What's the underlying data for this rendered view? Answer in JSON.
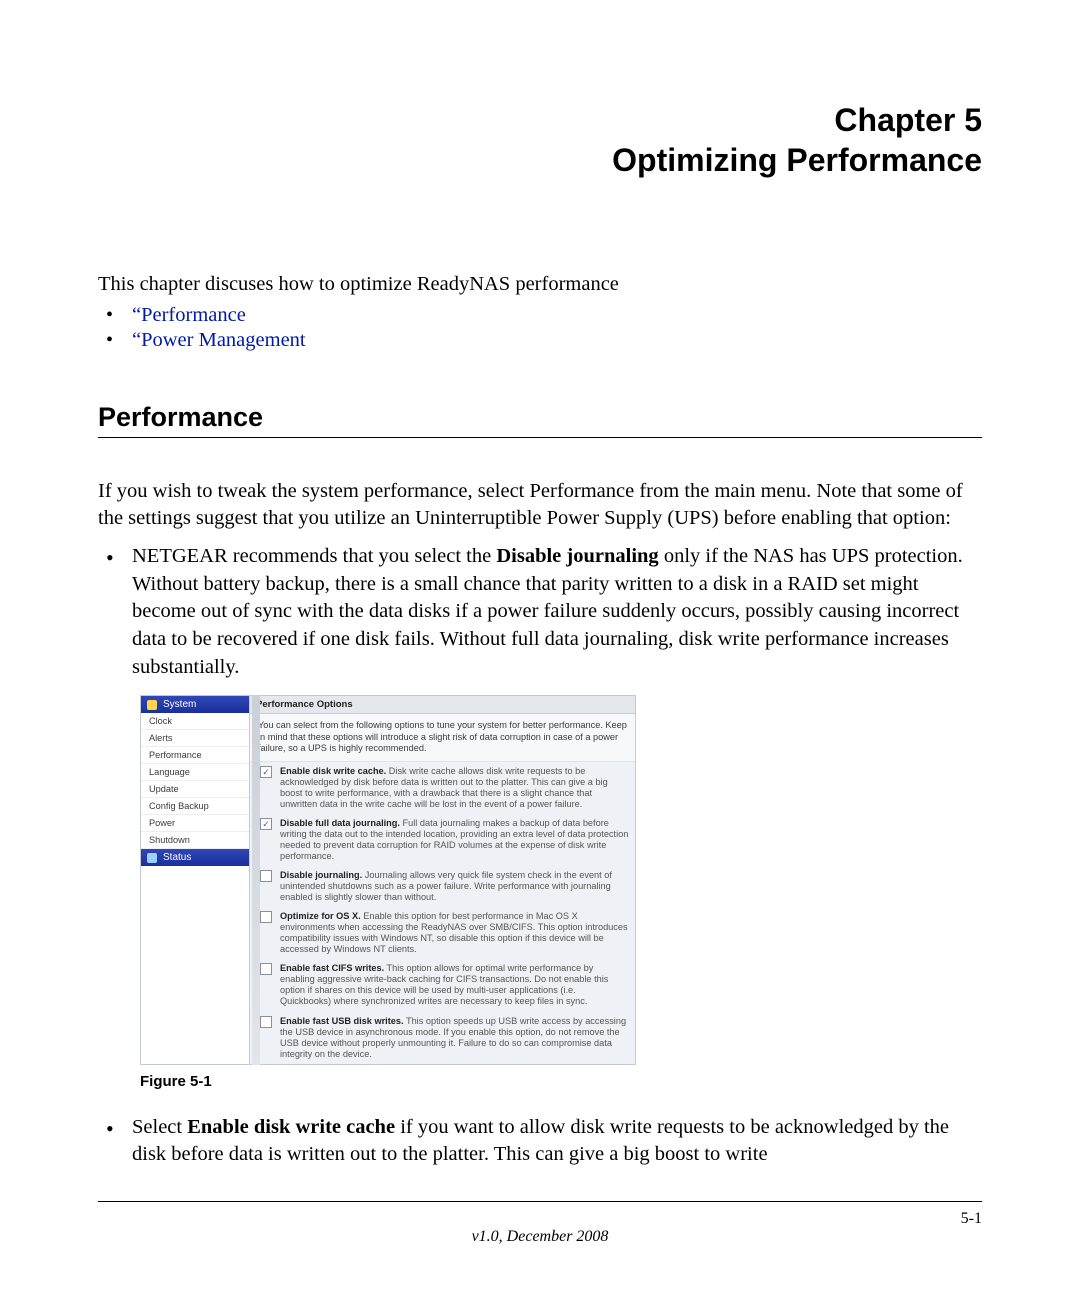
{
  "chapter": {
    "label": "Chapter 5",
    "title": "Optimizing Performance"
  },
  "intro": "This chapter discuses how to optimize ReadyNAS performance",
  "toc": {
    "item1": "“Performance",
    "item2": "“Power Management"
  },
  "section_heading": "Performance",
  "para1": "If you wish to tweak the system performance, select Performance from the main menu. Note that some of the settings suggest that you utilize an Uninterruptible Power Supply (UPS) before enabling that option:",
  "bullet1": {
    "pre": "NETGEAR recommends that you select the ",
    "bold": "Disable journaling",
    "post": " only if the NAS has UPS protection. Without battery backup, there is a small chance that parity written to a disk in a RAID set might become out of sync with the data disks if a power failure suddenly occurs, possibly causing incorrect data to be recovered if one disk fails. Without full data journaling, disk write performance increases substantially."
  },
  "bullet2": {
    "pre": "Select ",
    "bold": "Enable disk write cache",
    "post": " if you want to allow disk write requests to be acknowledged by the disk before data is written out to the platter. This can give a big boost to write"
  },
  "figure_label": "Figure 5-1",
  "sidebar": {
    "header_system": "System",
    "items": [
      "Clock",
      "Alerts",
      "Performance",
      "Language",
      "Update",
      "Config Backup",
      "Power",
      "Shutdown"
    ],
    "header_status": "Status"
  },
  "panel": {
    "title": "Performance Options",
    "note": "You can select from the following options to tune your system for better performance. Keep in mind that these options will introduce a slight risk of data corruption in case of a power failure, so a UPS is highly recommended.",
    "opts": [
      {
        "checked": true,
        "title": "Enable disk write cache.",
        "body": "Disk write cache allows disk write requests to be acknowledged by disk before data is written out to the platter. This can give a big boost to write performance, with a drawback that there is a slight chance that unwritten data in the write cache will be lost in the event of a power failure."
      },
      {
        "checked": true,
        "title": "Disable full data journaling.",
        "body": "Full data journaling makes a backup of data before writing the data out to the intended location, providing an extra level of data protection needed to prevent data corruption for RAID volumes at the expense of disk write performance."
      },
      {
        "checked": false,
        "title": "Disable journaling.",
        "body": "Journaling allows very quick file system check in the event of unintended shutdowns such as a power failure. Write performance with journaling enabled is slightly slower than without."
      },
      {
        "checked": false,
        "title": "Optimize for OS X.",
        "body": "Enable this option for best performance in Mac OS X environments when accessing the ReadyNAS over SMB/CIFS. This option introduces compatibility issues with Windows NT, so disable this option if this device will be accessed by Windows NT clients."
      },
      {
        "checked": false,
        "title": "Enable fast CIFS writes.",
        "body": "This option allows for optimal write performance by enabling aggressive write-back caching for CIFS transactions. Do not enable this option if shares on this device will be used by multi-user applications (i.e. Quickbooks) where synchronized writes are necessary to keep files in sync."
      },
      {
        "checked": false,
        "title": "Enable fast USB disk writes.",
        "body": "This option speeds up USB write access by accessing the USB device in asynchronous mode. If you enable this option, do not remove the USB device without properly unmounting it. Failure to do so can compromise data integrity on the device."
      }
    ]
  },
  "footer": {
    "page": "5-1",
    "version": "v1.0, December 2008"
  }
}
